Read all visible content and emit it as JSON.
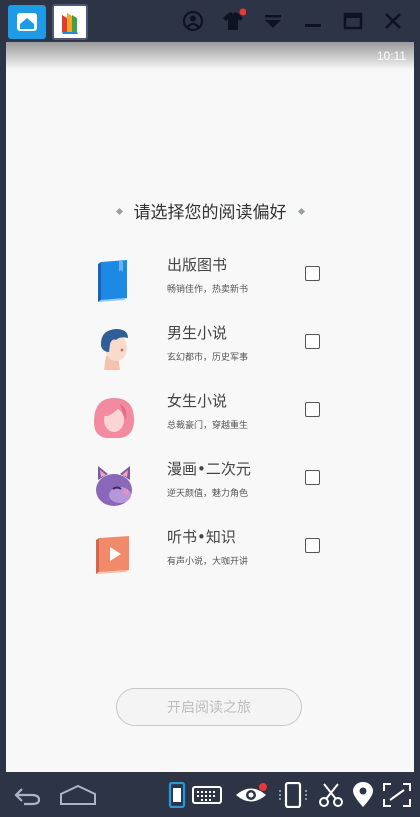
{
  "emulator": {
    "top_icons": [
      "home-icon",
      "app-logo-icon",
      "account-icon",
      "shirt-icon",
      "menu-dropdown-icon",
      "minimize-icon",
      "maximize-icon",
      "close-icon"
    ],
    "bottom_icons": [
      "back-icon",
      "home-outline-icon",
      "portrait-icon",
      "keyboard-icon",
      "eye-icon",
      "phone-rotate-icon",
      "scissors-icon",
      "location-icon",
      "fullscreen-icon"
    ],
    "colors": {
      "frame": "#2c3446",
      "accent_blue": "#1e9be6",
      "notify_red": "#e53935"
    }
  },
  "status": {
    "time": "10:11"
  },
  "page": {
    "heading": "请选择您的阅读偏好",
    "options": [
      {
        "title": "出版图书",
        "subtitle": "畅销佳作，热卖新书",
        "icon": "blue-book-icon",
        "checked": false
      },
      {
        "title": "男生小说",
        "subtitle": "玄幻都市，历史军事",
        "icon": "boy-avatar-icon",
        "checked": false
      },
      {
        "title": "女生小说",
        "subtitle": "总裁豪门，穿越重生",
        "icon": "girl-avatar-icon",
        "checked": false
      },
      {
        "title": "漫画•二次元",
        "subtitle": "逆天颜值，魅力角色",
        "icon": "purple-cat-icon",
        "checked": false
      },
      {
        "title": "听书•知识",
        "subtitle": "有声小说，大咖开讲",
        "icon": "audio-book-icon",
        "checked": false
      }
    ],
    "start_button": "开启阅读之旅"
  }
}
